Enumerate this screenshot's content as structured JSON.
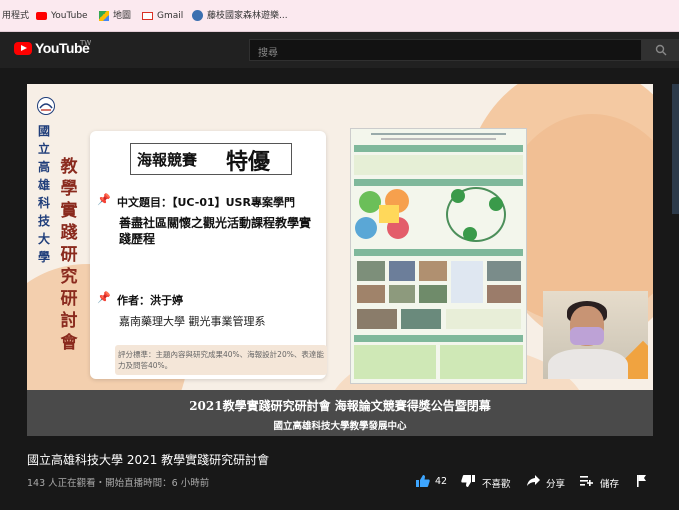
{
  "bookmarks": [
    {
      "label": "用程式",
      "icon": "apps-icon"
    },
    {
      "label": "YouTube",
      "icon": "youtube-icon"
    },
    {
      "label": "地圖",
      "icon": "maps-icon"
    },
    {
      "label": "Gmail",
      "icon": "gmail-icon"
    },
    {
      "label": "藤枝國家森林遊樂...",
      "icon": "site-icon"
    }
  ],
  "header": {
    "logo_text": "YouTube",
    "region": "TW",
    "search_placeholder": "搜尋"
  },
  "slide": {
    "vertical_school": "國立高雄科技大學",
    "vertical_event": "教學實踐研究研討會",
    "award_prefix": "海報競賽",
    "award_level": "特優",
    "topic_label": "中文題目：【UC-01】USR專案學門",
    "topic_title": "善盡社區關懷之觀光活動課程教學實踐歷程",
    "author_label": "作者：洪于婷",
    "affiliation": "嘉南藥理大學 觀光事業管理系",
    "criteria": "評分標準：主題內容與研究成果40%、海報設計20%、表達能力及問答40%。",
    "banner_line1": "2021教學實踐研究研討會 海報論文競賽得獎公告暨閉幕",
    "banner_line2": "國立高雄科技大學教學發展中心"
  },
  "video": {
    "title": "國立高雄科技大學 2021 教學實踐研究研討會",
    "meta": "143 人正在觀看・開始直播時間：6 小時前",
    "likes": "42",
    "dislike_label": "不喜歡",
    "share_label": "分享",
    "save_label": "儲存"
  },
  "colors": {
    "accent": "#ff0000",
    "like_blue": "#3ea6ff",
    "background": "#181818"
  }
}
